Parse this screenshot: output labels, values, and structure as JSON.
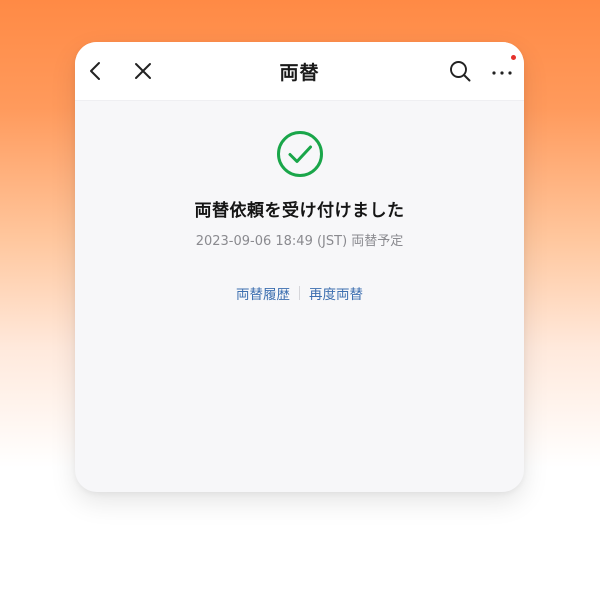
{
  "navbar": {
    "title": "両替",
    "back_icon": "chevron-left-icon",
    "close_icon": "close-icon",
    "search_icon": "search-icon",
    "more_icon": "more-dots-icon",
    "notification_color": "#e5312c"
  },
  "result": {
    "status_icon": "check-circle-icon",
    "status_color": "#1aa64a",
    "headline": "両替依頼を受け付けました",
    "subline": "2023-09-06 18:49 (JST) 両替予定"
  },
  "actions": {
    "history_label": "両替履歴",
    "retry_label": "再度両替",
    "link_color": "#3d6fb0"
  }
}
